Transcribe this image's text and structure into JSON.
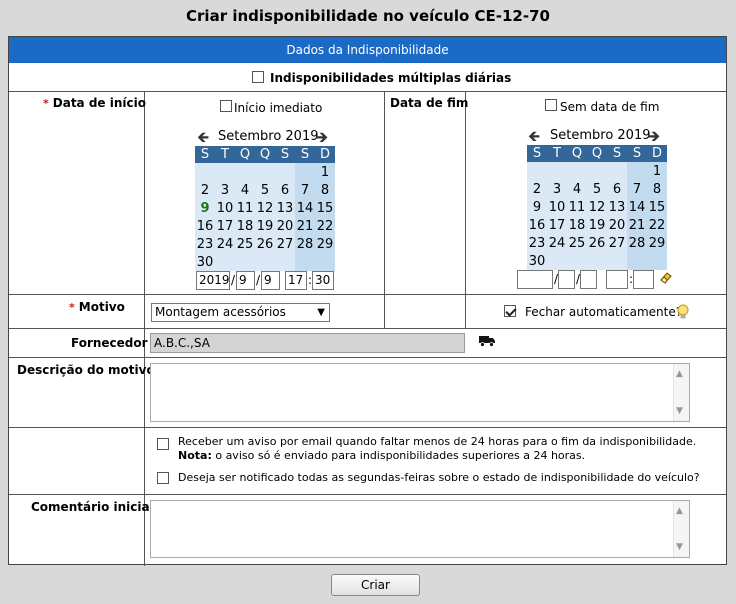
{
  "window": {
    "title": "Criar indisponibilidade no veículo CE-12-70"
  },
  "section": {
    "header": "Dados da Indisponibilidade"
  },
  "multi_daily": {
    "label": "Indisponibilidades múltiplas diárias",
    "checked": false
  },
  "start": {
    "label": "Data de início",
    "required_mark": "*",
    "immediate_label": "Início imediato",
    "month_label": "Setembro 2019",
    "year": "2019",
    "month": "9",
    "day": "9",
    "hour": "17",
    "minute": "30"
  },
  "end": {
    "label": "Data de fim",
    "no_end_label": "Sem data de fim",
    "month_label": "Setembro 2019",
    "year": "",
    "month": "",
    "day": "",
    "hour": "",
    "minute": ""
  },
  "calendar": {
    "weekdays": [
      "S",
      "T",
      "Q",
      "Q",
      "S",
      "S",
      "D"
    ],
    "weeks": [
      [
        "",
        "",
        "",
        "",
        "",
        "",
        "1"
      ],
      [
        "2",
        "3",
        "4",
        "5",
        "6",
        "7",
        "8"
      ],
      [
        "9",
        "10",
        "11",
        "12",
        "13",
        "14",
        "15"
      ],
      [
        "16",
        "17",
        "18",
        "19",
        "20",
        "21",
        "22"
      ],
      [
        "23",
        "24",
        "25",
        "26",
        "27",
        "28",
        "29"
      ],
      [
        "30",
        "",
        "",
        "",
        "",
        "",
        ""
      ]
    ],
    "today": "9"
  },
  "reason": {
    "label": "Motivo",
    "required_mark": "*",
    "selected": "Montagem acessórios",
    "auto_close_label": "Fechar automaticamente?",
    "auto_close_checked": true
  },
  "supplier": {
    "label": "Fornecedor",
    "value": "A.B.C.,SA"
  },
  "description": {
    "label": "Descrição do motivo"
  },
  "notifications": {
    "email_alert": "Receber um aviso por email quando faltar menos de 24 horas para o fim da indisponibilidade.",
    "note_label": "Nota:",
    "note_text": "o aviso só é enviado para indisponibilidades superiores a 24 horas.",
    "weekly": "Deseja ser notificado todas as segundas-feiras sobre o estado de indisponibilidade do veículo?"
  },
  "comment": {
    "label": "Comentário inicial"
  },
  "actions": {
    "create": "Criar"
  }
}
